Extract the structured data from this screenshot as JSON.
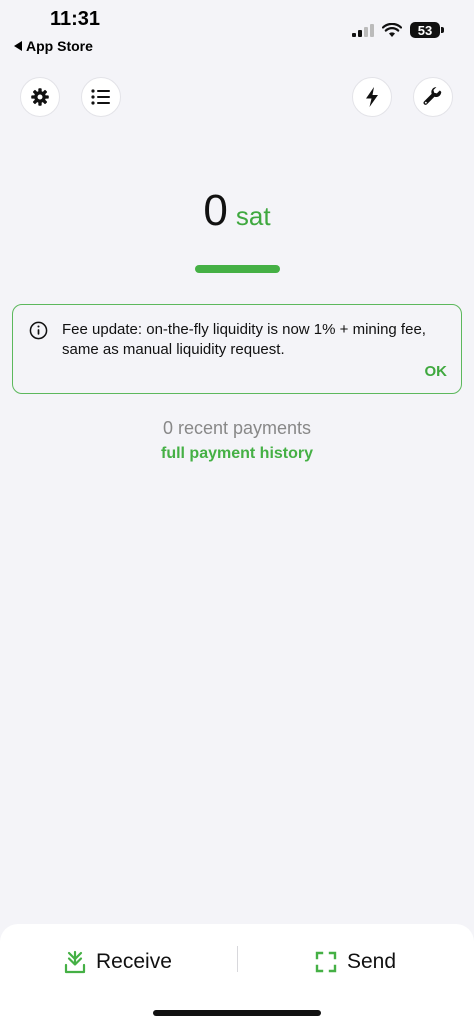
{
  "status_bar": {
    "time": "11:31",
    "back_label": "App Store",
    "battery": "53"
  },
  "toolbar": {
    "left": [
      "gear-icon",
      "list-icon"
    ],
    "right": [
      "lightning-icon",
      "wrench-icon"
    ]
  },
  "balance": {
    "amount": "0",
    "unit": "sat"
  },
  "notice": {
    "text": "Fee update: on-the-fly liquidity is now 1% + mining fee, same as manual liquidity request.",
    "ok_label": "OK"
  },
  "payments": {
    "recent_label": "0 recent payments",
    "history_link": "full payment history"
  },
  "bottom_bar": {
    "receive_label": "Receive",
    "send_label": "Send"
  },
  "colors": {
    "accent": "#45b045",
    "background": "#f4f4f8",
    "text": "#111111",
    "muted": "#888888"
  }
}
